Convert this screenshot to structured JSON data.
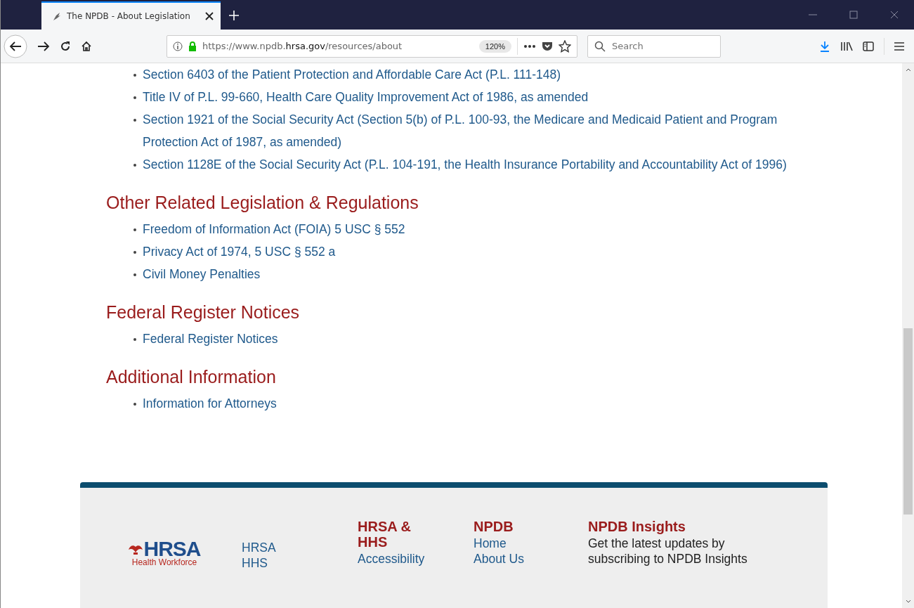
{
  "window": {
    "tab_title": "The NPDB - About Legislation ",
    "url_prefix": "https://www.npdb.",
    "url_domain": "hrsa.gov",
    "url_rest": "/resources/about",
    "zoom": "120%",
    "search_placeholder": "Search"
  },
  "top_links": [
    {
      "text": "Section 6403 of the Patient Protection and Affordable Care Act (P.L. 111-148)"
    },
    {
      "text": "Title IV of P.L. 99-660, Health Care Quality Improvement Act of 1986, as amended"
    },
    {
      "text": "Section 1921 of the Social Security Act (Section 5(b) of P.L. 100-93, the Medicare and Medicaid Patient and Program Protection Act of 1987, as amended)"
    },
    {
      "text": "Section 1128E of the Social Security Act (P.L. 104-191, the Health Insurance Portability and Accountability Act of 1996)"
    }
  ],
  "sections": [
    {
      "heading": "Other Related Legislation & Regulations",
      "links": [
        "Freedom of Information Act (FOIA) 5 USC § 552",
        "Privacy Act of 1974, 5 USC § 552 a",
        "Civil Money Penalties"
      ]
    },
    {
      "heading": "Federal Register Notices",
      "links": [
        "Federal Register Notices"
      ]
    },
    {
      "heading": "Additional Information",
      "links": [
        "Information for Attorneys"
      ]
    }
  ],
  "footer": {
    "logo_text": "HRSA",
    "logo_subtitle": "Health Workforce",
    "columns": [
      {
        "links": [
          "HRSA",
          "HHS"
        ]
      },
      {
        "heading": "HRSA & HHS",
        "links": [
          "Accessibility"
        ]
      },
      {
        "heading": "NPDB",
        "links": [
          "Home",
          "About Us"
        ]
      },
      {
        "heading": "NPDB Insights",
        "text": "Get the latest updates by subscribing to NPDB Insights"
      }
    ]
  }
}
